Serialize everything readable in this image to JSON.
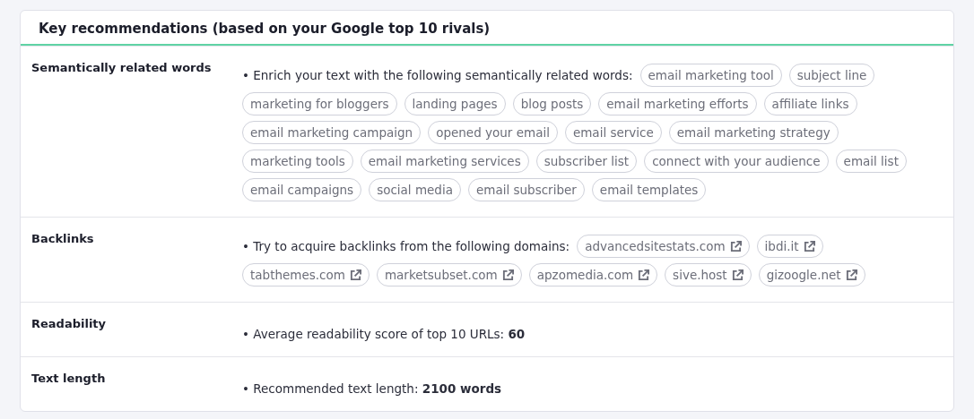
{
  "title": "Key recommendations (based on your Google top 10 rivals)",
  "rows": [
    {
      "label": "Semantically related words",
      "kind": "chips",
      "text": "• Enrich your text with the following semantically related words:",
      "chips": [
        "email marketing tool",
        "subject line",
        "marketing for bloggers",
        "landing pages",
        "blog posts",
        "email marketing efforts",
        "affiliate links",
        "email marketing campaign",
        "opened your email",
        "email service",
        "email marketing strategy",
        "marketing tools",
        "email marketing services",
        "subscriber list",
        "connect with your audience",
        "email list",
        "email campaigns",
        "social media",
        "email subscriber",
        "email templates"
      ]
    },
    {
      "label": "Backlinks",
      "kind": "links",
      "text": "• Try to acquire backlinks from the following domains:",
      "chips": [
        "advancedsitestats.com",
        "ibdi.it",
        "tabthemes.com",
        "marketsubset.com",
        "apzomedia.com",
        "sive.host",
        "gizoogle.net"
      ]
    },
    {
      "label": "Readability",
      "kind": "text",
      "text": "• Average readability score of top 10 URLs: **60**"
    },
    {
      "label": "Text length",
      "kind": "text",
      "text": "• Recommended text length: **2100 words**"
    }
  ]
}
